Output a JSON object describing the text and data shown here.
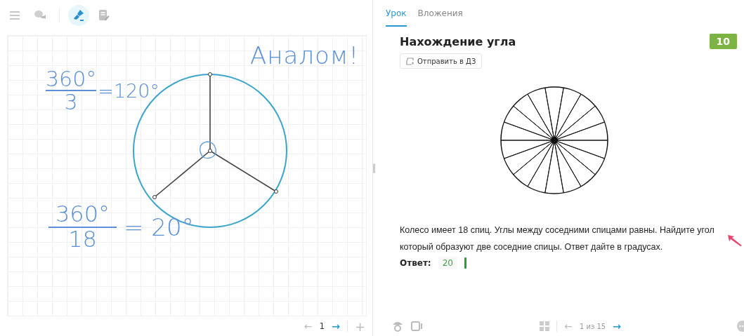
{
  "toolbar": {
    "tools": [
      {
        "kind": "menu",
        "selected": false
      },
      {
        "kind": "chat",
        "selected": false
      },
      {
        "kind": "brush",
        "selected": true
      },
      {
        "kind": "note",
        "selected": false
      }
    ]
  },
  "board": {
    "notes": [
      {
        "kind": "word",
        "text": "Аналом!"
      },
      {
        "kind": "fraction",
        "numerator": "360°",
        "denominator": "3",
        "result": "=120°"
      },
      {
        "kind": "fraction",
        "numerator": "360°",
        "denominator": "18",
        "result": "= 20°"
      }
    ]
  },
  "board_pager": {
    "prev": "←",
    "page": "1",
    "next": "→",
    "add": "+"
  },
  "tabs": [
    {
      "label": "Урок",
      "selected": true
    },
    {
      "label": "Вложения",
      "selected": false
    }
  ],
  "task": {
    "title": "Нахождение угла",
    "score": "10",
    "send_button": "Отправить в ДЗ",
    "text": "Колесо имеет 18 спиц. Углы между соседними спицами равны. Найдите угол который образуют две соседние спицы. Ответ дайте в градусах.",
    "answer_label": "Ответ:",
    "answer": "20"
  },
  "pager": {
    "prev": "←",
    "label": "1 из 15",
    "next": "→"
  }
}
